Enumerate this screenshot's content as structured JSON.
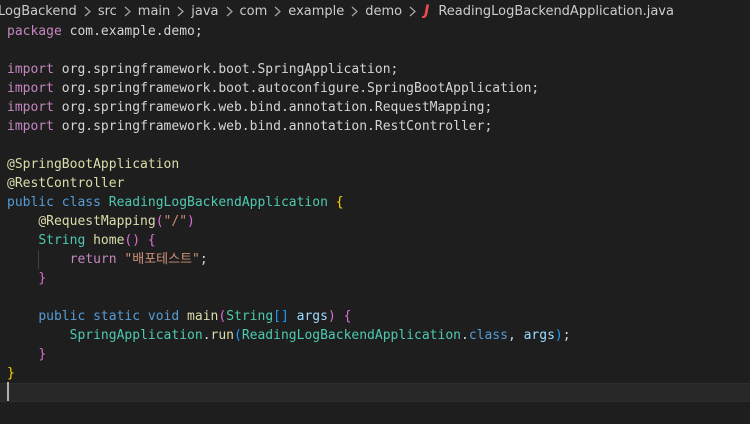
{
  "breadcrumb": {
    "items": [
      "LogBackend",
      "src",
      "main",
      "java",
      "com",
      "example",
      "demo"
    ],
    "file_icon": "J",
    "file": "ReadingLogBackendApplication.java"
  },
  "code": {
    "package_kw": "package",
    "package_name": "com.example.demo",
    "import_kw": "import",
    "imports": [
      "org.springframework.boot.SpringApplication",
      "org.springframework.boot.autoconfigure.SpringBootApplication",
      "org.springframework.web.bind.annotation.RequestMapping",
      "org.springframework.web.bind.annotation.RestController"
    ],
    "annotations": [
      "@SpringBootApplication",
      "@RestController"
    ],
    "public_kw": "public",
    "class_kw": "class",
    "class_name": "ReadingLogBackendApplication",
    "request_mapping": "@RequestMapping",
    "request_mapping_arg": "\"/\"",
    "string_type": "String",
    "home_fn": "home",
    "return_kw": "return",
    "return_value": "\"배포테스트\"",
    "static_kw": "static",
    "void_kw": "void",
    "main_fn": "main",
    "args_param": "args",
    "spring_app": "SpringApplication",
    "run_fn": "run",
    "class_literal_kw": "class"
  },
  "colors": {
    "background": "#1e1e1e",
    "keyword": "#569cd6",
    "import_keyword": "#c586c0",
    "annotation": "#dcdcaa",
    "type": "#4ec9b0",
    "string": "#ce9178",
    "bracket_gold": "#ffd700",
    "bracket_purple": "#da70d6",
    "bracket_blue": "#179fff"
  },
  "icons": {
    "separator": "chevron-right-icon",
    "file": "java-file-icon"
  }
}
